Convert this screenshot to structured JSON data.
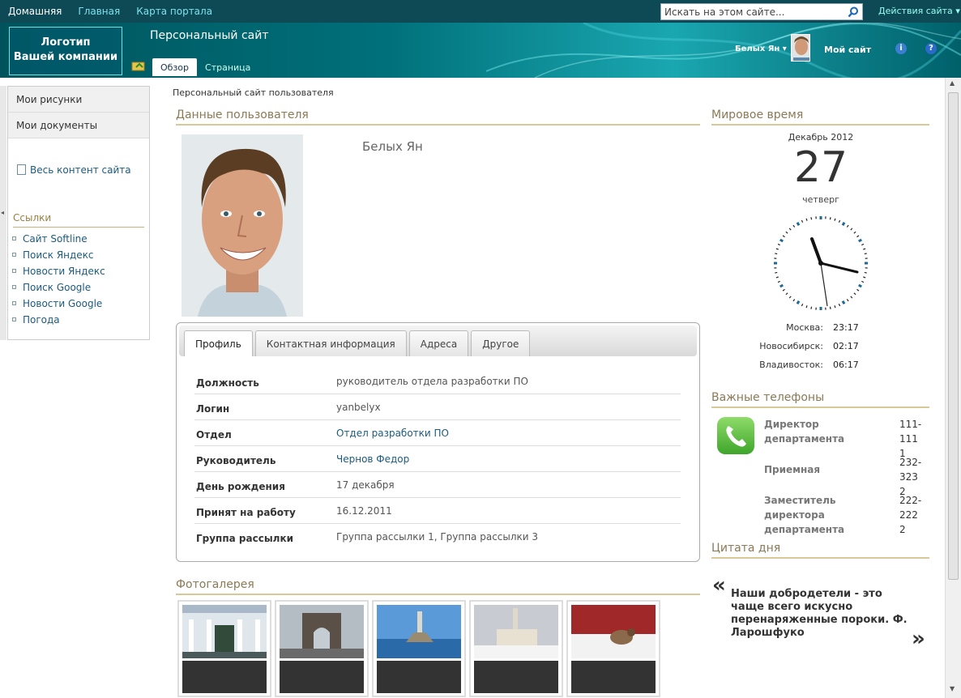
{
  "topbar": {
    "nav": [
      "Домашняя",
      "Главная",
      "Карта портала"
    ],
    "search_placeholder": "Искать на этом сайте...",
    "site_actions": "Действия сайта"
  },
  "banner": {
    "logo_line1": "Логотип",
    "logo_line2": "Вашей компании",
    "site_title": "Персональный сайт",
    "tabs": [
      "Обзор",
      "Страница"
    ],
    "user": "Белых Ян",
    "my_site": "Мой сайт",
    "info_icon": "i",
    "help_icon": "?"
  },
  "leftnav": {
    "items": [
      "Мои рисунки",
      "Мои документы"
    ],
    "all_content": "Весь контент сайта",
    "links_title": "Ссылки",
    "links": [
      "Сайт Softline",
      "Поиск Яндекс",
      "Новости Яндекс",
      "Поиск Google",
      "Новости Google",
      "Погода"
    ]
  },
  "breadcrumb": "Персональный сайт пользователя",
  "profile": {
    "section_title": "Данные пользователя",
    "name": "Белых Ян",
    "tabs": [
      "Профиль",
      "Контактная информация",
      "Адреса",
      "Другое"
    ],
    "rows": [
      {
        "k": "Должность",
        "v": "руководитель отдела разработки ПО"
      },
      {
        "k": "Логин",
        "v": "yanbelyx"
      },
      {
        "k": "Отдел",
        "v": "Отдел разработки ПО"
      },
      {
        "k": "Руководитель",
        "v": "Чернов Федор"
      },
      {
        "k": "День рождения",
        "v": "17 декабря"
      },
      {
        "k": "Принят на работу",
        "v": "16.12.2011"
      },
      {
        "k": "Группа рассылки",
        "v": "Группа рассылки 1, Группа рассылки 3"
      }
    ]
  },
  "gallery": {
    "title": "Фотогалерея"
  },
  "worldtime": {
    "title": "Мировое время",
    "month": "Декабрь 2012",
    "day": "27",
    "weekday": "четверг",
    "cities": [
      {
        "city": "Москва:",
        "time": "23:17"
      },
      {
        "city": "Новосибирск:",
        "time": "02:17"
      },
      {
        "city": "Владивосток:",
        "time": "06:17"
      }
    ]
  },
  "phones": {
    "title": "Важные телефоны",
    "items": [
      {
        "name": "Директор департамента",
        "num": "111-1111"
      },
      {
        "name": "Приемная",
        "num": "232-3232"
      },
      {
        "name": "Заместитель директора департамента",
        "num": "222-2222"
      }
    ]
  },
  "quote": {
    "title": "Цитата дня",
    "text": "Наши добродетели - это чаще всего искусно перенаряженные пороки. Ф. Ларошфуко",
    "open": "«",
    "close": "»"
  }
}
